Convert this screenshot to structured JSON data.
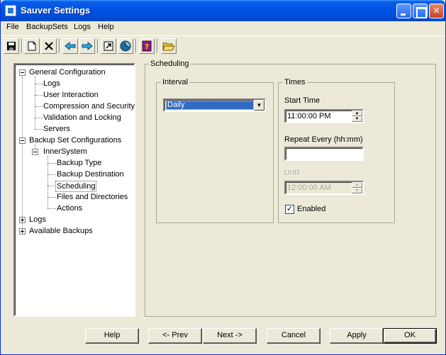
{
  "window": {
    "title": "Sauver Settings"
  },
  "menu": [
    "File",
    "BackupSets",
    "Logs",
    "Help"
  ],
  "toolbar": {
    "icons": [
      "save-icon",
      "new-icon",
      "delete-icon",
      "back-arrow-icon",
      "forward-arrow-icon",
      "shortcut-icon",
      "clock-icon",
      "help-book-icon",
      "open-folder-icon"
    ]
  },
  "tree": {
    "general": "General Configuration",
    "general_children": [
      "Logs",
      "User Interaction",
      "Compression and Security",
      "Validation and Locking",
      "Servers"
    ],
    "backupsets": "Backup Set Configurations",
    "innersystem": "InnerSystem",
    "innersystem_children": [
      "Backup Type",
      "Backup Destination",
      "Scheduling",
      "Files and Directories",
      "Actions"
    ],
    "logs": "Logs",
    "available": "Available Backups",
    "selected": "Scheduling"
  },
  "panel": {
    "title": "Scheduling",
    "interval": {
      "label": "Interval",
      "value": "Daily"
    },
    "times": {
      "label": "Times",
      "start_label": "Start Time",
      "start_value": "11:00:00 PM",
      "repeat_label": "Repeat Every  (hh:mm)",
      "repeat_value": "",
      "until_label": "Until",
      "until_value": "12:00:00 AM",
      "enabled_label": "Enabled",
      "enabled_checked": true
    }
  },
  "buttons": {
    "help": "Help",
    "prev": "<- Prev",
    "next": "Next ->",
    "cancel": "Cancel",
    "apply": "Apply",
    "ok": "OK"
  }
}
